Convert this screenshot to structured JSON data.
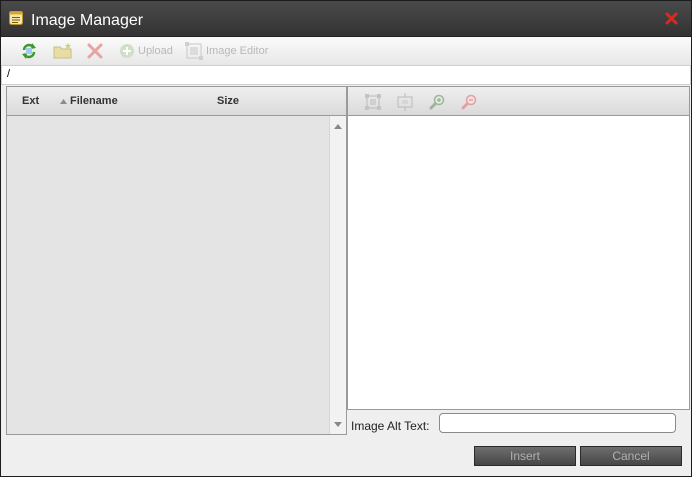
{
  "window": {
    "title": "Image Manager",
    "colors": {
      "titlebar": "#3c3c3c",
      "close": "#d92b1c",
      "refresh": "#3a9a2e"
    }
  },
  "toolbar": {
    "refresh_icon": "refresh-icon",
    "new_folder_icon": "new-folder-icon",
    "delete_icon": "delete-icon",
    "upload_label": "Upload",
    "image_editor_label": "Image Editor"
  },
  "path": {
    "current": "/"
  },
  "file_list": {
    "columns": [
      "Ext",
      "Filename",
      "Size"
    ],
    "sort_column": "Filename",
    "rows": []
  },
  "preview": {
    "tools": [
      "fit-to-window-icon",
      "actual-size-icon",
      "zoom-in-icon",
      "zoom-out-icon"
    ]
  },
  "alt_text": {
    "label": "Image Alt Text:",
    "value": ""
  },
  "buttons": {
    "insert": "Insert",
    "cancel": "Cancel"
  }
}
